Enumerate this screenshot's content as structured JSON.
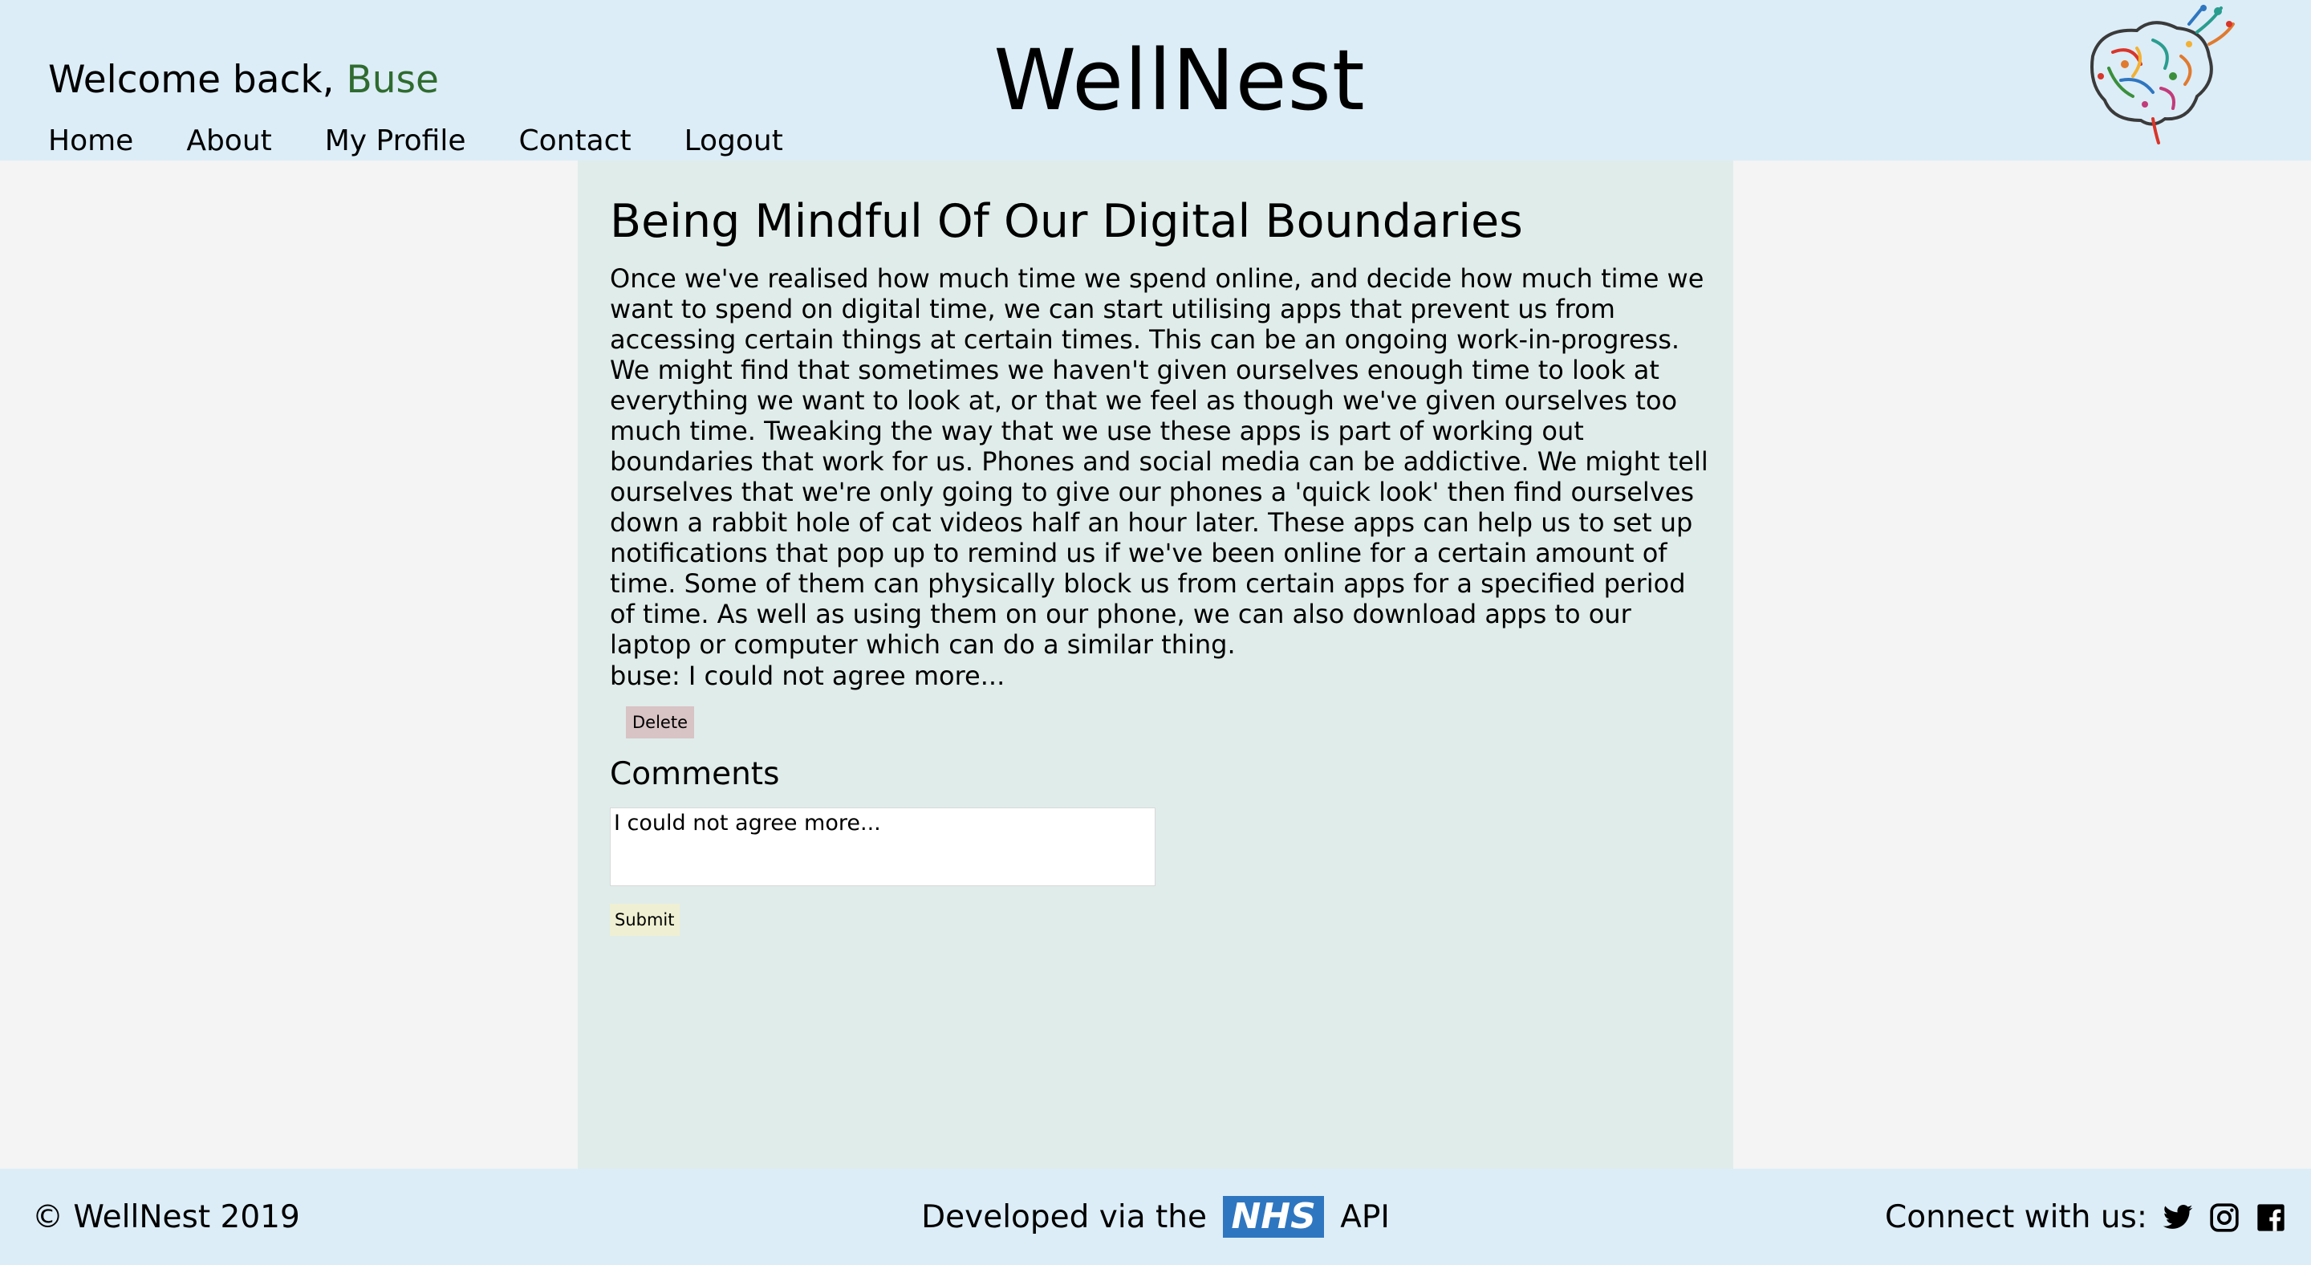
{
  "header": {
    "welcome_prefix": "Welcome back,",
    "username": "Buse",
    "site_title": "WellNest",
    "nav": {
      "home": "Home",
      "about": "About",
      "profile": "My Profile",
      "contact": "Contact",
      "logout": "Logout"
    },
    "logo_icon": "brain-icon"
  },
  "article": {
    "title": "Being Mindful Of Our Digital Boundaries",
    "body": "Once we've realised how much time we spend online, and decide how much time we want to spend on digital time, we can start utilising apps that prevent us from accessing certain things at certain times. This can be an ongoing work-in-progress. We might find that sometimes we haven't given ourselves enough time to look at everything we want to look at, or that we feel as though we've given ourselves too much time. Tweaking the way that we use these apps is part of working out boundaries that work for us. Phones and social media can be addictive. We might tell ourselves that we're only going to give our phones a 'quick look' then find ourselves down a rabbit hole of cat videos half an hour later. These apps can help us to set up notifications that pop up to remind us if we've been online for a certain amount of time. Some of them can physically block us from certain apps for a specified period of time. As well as using them on our phone, we can also download apps to our laptop or computer which can do a similar thing."
  },
  "comments": {
    "existing": "buse: I could not agree more...",
    "delete_label": "Delete",
    "heading": "Comments",
    "input_value": "I could not agree more...",
    "submit_label": "Submit"
  },
  "footer": {
    "copyright": "© WellNest 2019",
    "developed_prefix": "Developed via the",
    "nhs": "NHS",
    "developed_suffix": "API",
    "connect": "Connect with us:",
    "icons": [
      "twitter-icon",
      "instagram-icon",
      "facebook-icon"
    ]
  },
  "colors": {
    "header_bg": "#dcedf7",
    "main_bg": "#e0ecea",
    "page_bg": "#f4f4f4",
    "username": "#2f6b2f",
    "nhs_blue": "#2f76c0",
    "delete_bg": "#d8c3c5",
    "submit_bg": "#efefd3"
  }
}
